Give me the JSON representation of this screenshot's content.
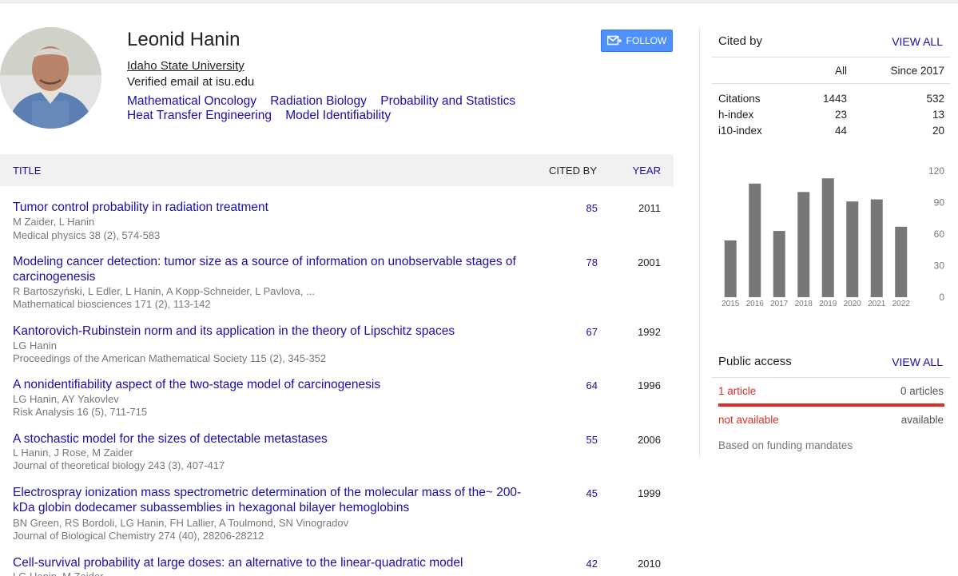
{
  "profile": {
    "name": "Leonid Hanin",
    "affiliation": "Idaho State University",
    "email": "Verified email at isu.edu",
    "interests": [
      "Mathematical Oncology",
      "Radiation Biology",
      "Probability and Statistics",
      "Heat Transfer Engineering",
      "Model Identifiability"
    ],
    "follow_label": "FOLLOW"
  },
  "table": {
    "headers": {
      "title": "TITLE",
      "cited_by": "CITED BY",
      "year": "YEAR"
    },
    "rows": [
      {
        "title": "Tumor control probability in radiation treatment",
        "authors": "M Zaider, L Hanin",
        "journal": "Medical physics 38 (2), 574-583",
        "cited": "85",
        "year": "2011"
      },
      {
        "title": "Modeling cancer detection: tumor size as a source of information on unobservable stages of carcinogenesis",
        "authors": "R Bartoszyński, L Edler, L Hanin, A Kopp-Schneider, L Pavlova, ...",
        "journal": "Mathematical biosciences 171 (2), 113-142",
        "cited": "78",
        "year": "2001"
      },
      {
        "title": "Kantorovich-Rubinstein norm and its application in the theory of Lipschitz spaces",
        "authors": "LG Hanin",
        "journal": "Proceedings of the American Mathematical Society 115 (2), 345-352",
        "cited": "67",
        "year": "1992"
      },
      {
        "title": "A nonidentifiability aspect of the two-stage model of carcinogenesis",
        "authors": "LG Hanin, AY Yakovlev",
        "journal": "Risk Analysis 16 (5), 711-715",
        "cited": "64",
        "year": "1996"
      },
      {
        "title": "A stochastic model for the sizes of detectable metastases",
        "authors": "L Hanin, J Rose, M Zaider",
        "journal": "Journal of theoretical biology 243 (3), 407-417",
        "cited": "55",
        "year": "2006"
      },
      {
        "title": "Electrospray ionization mass spectrometric determination of the molecular mass of the~ 200-kDa globin dodecamer subassemblies in hexagonal bilayer hemoglobins",
        "authors": "BN Green, RS Bordoli, LG Hanin, FH Lallier, A Toulmond, SN Vinogradov",
        "journal": "Journal of Biological Chemistry 274 (40), 28206-28212",
        "cited": "45",
        "year": "1999"
      },
      {
        "title": "Cell-survival probability at large doses: an alternative to the linear-quadratic model",
        "authors": "LG Hanin, M Zaider",
        "journal": "",
        "cited": "42",
        "year": "2010"
      }
    ]
  },
  "cited_by": {
    "title": "Cited by",
    "view_all": "VIEW ALL",
    "col_all": "All",
    "col_since": "Since 2017",
    "stats": [
      {
        "label": "Citations",
        "all": "1443",
        "since": "532"
      },
      {
        "label": "h-index",
        "all": "23",
        "since": "13"
      },
      {
        "label": "i10-index",
        "all": "44",
        "since": "20"
      }
    ]
  },
  "chart_data": {
    "type": "bar",
    "categories": [
      "2015",
      "2016",
      "2017",
      "2018",
      "2019",
      "2020",
      "2021",
      "2022"
    ],
    "values": [
      54,
      108,
      63,
      100,
      113,
      91,
      93,
      67
    ],
    "ylim": [
      0,
      120
    ],
    "yticks": [
      "120",
      "90",
      "60",
      "30",
      "0"
    ],
    "bar_color": "#777777"
  },
  "public_access": {
    "title": "Public access",
    "view_all": "VIEW ALL",
    "left_count": "1 article",
    "right_count": "0 articles",
    "left_label": "not available",
    "right_label": "available",
    "note": "Based on funding mandates"
  }
}
